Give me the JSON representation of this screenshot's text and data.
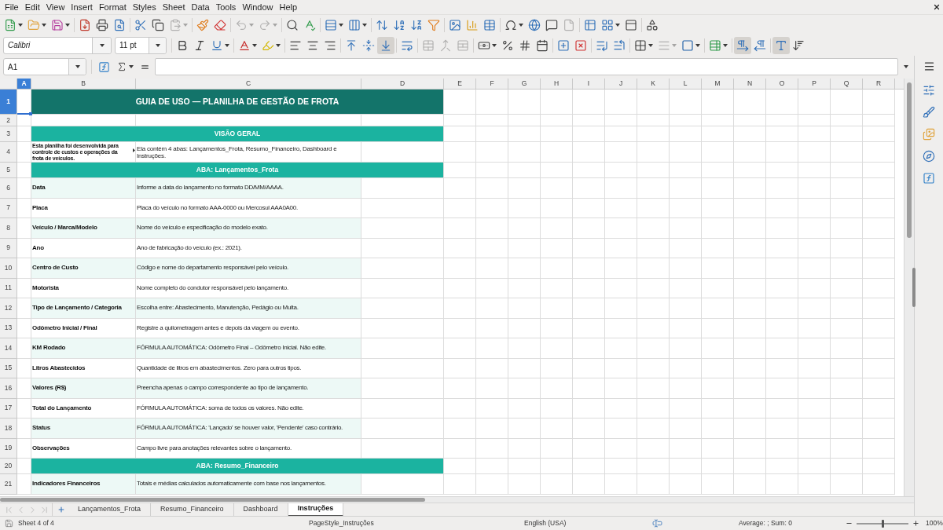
{
  "menu_bar": [
    "File",
    "Edit",
    "View",
    "Insert",
    "Format",
    "Styles",
    "Sheet",
    "Data",
    "Tools",
    "Window",
    "Help"
  ],
  "standard_toolbar": [
    {
      "kind": "new",
      "disabled": false
    },
    {
      "kind": "open",
      "disabled": false
    },
    {
      "kind": "save",
      "disabled": false
    },
    {
      "kind": "export_pdf",
      "disabled": false
    },
    {
      "kind": "print",
      "disabled": false
    },
    {
      "kind": "print_preview",
      "disabled": false
    },
    {
      "kind": "cut",
      "disabled": false
    },
    {
      "kind": "copy",
      "disabled": false
    },
    {
      "kind": "paste",
      "disabled": true
    },
    {
      "kind": "clone_formatting",
      "disabled": false
    },
    {
      "kind": "clear_formatting",
      "disabled": false
    },
    {
      "kind": "undo",
      "disabled": true
    },
    {
      "kind": "redo",
      "disabled": true
    },
    {
      "kind": "find_replace",
      "disabled": false
    },
    {
      "kind": "spelling",
      "disabled": false
    },
    {
      "kind": "row",
      "disabled": false
    },
    {
      "kind": "column",
      "disabled": false
    },
    {
      "kind": "sort",
      "disabled": false
    },
    {
      "kind": "sort_ascending",
      "disabled": false
    },
    {
      "kind": "sort_descending",
      "disabled": false
    },
    {
      "kind": "autofilter",
      "disabled": false
    },
    {
      "kind": "image",
      "disabled": false
    },
    {
      "kind": "chart",
      "disabled": false
    },
    {
      "kind": "pivot_table",
      "disabled": false
    },
    {
      "kind": "special_character",
      "disabled": false
    },
    {
      "kind": "hyperlink",
      "disabled": false
    },
    {
      "kind": "comment",
      "disabled": false
    },
    {
      "kind": "header_footer",
      "disabled": true
    },
    {
      "kind": "print_area",
      "disabled": false
    },
    {
      "kind": "freeze",
      "disabled": false
    },
    {
      "kind": "split_window",
      "disabled": false
    },
    {
      "kind": "draw_functions",
      "disabled": false
    }
  ],
  "formatting_toolbar": {
    "font_name": "Calibri",
    "font_size": "11 pt",
    "buttons": [
      {
        "kind": "bold",
        "disabled": false,
        "pressed": false
      },
      {
        "kind": "italic",
        "disabled": false,
        "pressed": false
      },
      {
        "kind": "underline",
        "disabled": false,
        "pressed": false
      },
      {
        "kind": "font_color",
        "disabled": false,
        "pressed": false
      },
      {
        "kind": "highlight",
        "disabled": false,
        "pressed": false
      },
      {
        "kind": "align_left",
        "disabled": false,
        "pressed": false
      },
      {
        "kind": "align_center",
        "disabled": false,
        "pressed": false
      },
      {
        "kind": "align_right",
        "disabled": false,
        "pressed": false
      },
      {
        "kind": "align_top",
        "disabled": false,
        "pressed": false
      },
      {
        "kind": "align_middle",
        "disabled": false,
        "pressed": false
      },
      {
        "kind": "align_bottom",
        "disabled": false,
        "pressed": true
      },
      {
        "kind": "wrap_text",
        "disabled": false,
        "pressed": false
      },
      {
        "kind": "merge_center",
        "disabled": true,
        "pressed": false
      },
      {
        "kind": "merge",
        "disabled": true,
        "pressed": false
      },
      {
        "kind": "unmerge",
        "disabled": true,
        "pressed": false
      },
      {
        "kind": "currency",
        "disabled": false,
        "pressed": false
      },
      {
        "kind": "percent",
        "disabled": false,
        "pressed": false
      },
      {
        "kind": "number",
        "disabled": false,
        "pressed": false
      },
      {
        "kind": "date",
        "disabled": false,
        "pressed": false
      },
      {
        "kind": "add_decimal",
        "disabled": false,
        "pressed": false
      },
      {
        "kind": "delete_decimal",
        "disabled": false,
        "pressed": false
      },
      {
        "kind": "increase_indent",
        "disabled": false,
        "pressed": false
      },
      {
        "kind": "decrease_indent",
        "disabled": false,
        "pressed": false
      },
      {
        "kind": "borders",
        "disabled": false,
        "pressed": false
      },
      {
        "kind": "border_style",
        "disabled": true,
        "pressed": false
      },
      {
        "kind": "border_color",
        "disabled": false,
        "pressed": false
      },
      {
        "kind": "conditional",
        "disabled": false,
        "pressed": false
      },
      {
        "kind": "left_to_right",
        "disabled": false,
        "pressed": true
      },
      {
        "kind": "right_to_left",
        "disabled": false,
        "pressed": false
      },
      {
        "kind": "text_horizontal",
        "disabled": false,
        "pressed": true
      },
      {
        "kind": "text_vertical",
        "disabled": false,
        "pressed": false
      }
    ]
  },
  "formula_bar": {
    "name_box": "A1"
  },
  "sheet": {
    "columns": [
      {
        "label": "A",
        "selected": true
      },
      {
        "label": "B",
        "selected": false
      },
      {
        "label": "C",
        "selected": false
      },
      {
        "label": "D",
        "selected": false
      },
      {
        "label": "E",
        "selected": false
      },
      {
        "label": "F",
        "selected": false
      },
      {
        "label": "G",
        "selected": false
      },
      {
        "label": "H",
        "selected": false
      },
      {
        "label": "I",
        "selected": false
      },
      {
        "label": "J",
        "selected": false
      },
      {
        "label": "K",
        "selected": false
      },
      {
        "label": "L",
        "selected": false
      },
      {
        "label": "M",
        "selected": false
      },
      {
        "label": "N",
        "selected": false
      },
      {
        "label": "O",
        "selected": false
      },
      {
        "label": "P",
        "selected": false
      },
      {
        "label": "Q",
        "selected": false
      },
      {
        "label": "R",
        "selected": false
      }
    ],
    "rows": [
      {
        "number": "1",
        "selected": true,
        "kind": "title",
        "text": "GUIA DE USO — PLANILHA DE GESTÃO DE FROTA"
      },
      {
        "number": "2",
        "selected": false,
        "kind": "blank"
      },
      {
        "number": "3",
        "selected": false,
        "kind": "section",
        "text": "VISÃO GERAL"
      },
      {
        "number": "4",
        "selected": false,
        "kind": "overview",
        "label": "Esta planilha foi desenvolvida para\ncontrole de custos e operações da\nfrota de veículos.",
        "label_clipped": true,
        "description": "Ela contém 4 abas: Lançamentos_Frota, Resumo_Financeiro, Dashboard e Instruções."
      },
      {
        "number": "5",
        "selected": false,
        "kind": "section",
        "text": "ABA: Lançamentos_Frota"
      },
      {
        "number": "6",
        "selected": false,
        "kind": "entry",
        "label": "Data",
        "description": "Informe a data do lançamento no formato DD/MM/AAAA."
      },
      {
        "number": "7",
        "selected": false,
        "kind": "entry",
        "label": "Placa",
        "description": "Placa do veículo no formato AAA-0000 ou Mercosul AAA0A00."
      },
      {
        "number": "8",
        "selected": false,
        "kind": "entry",
        "label": "Veículo / Marca/Modelo",
        "description": "Nome do veículo e especificação do modelo exato."
      },
      {
        "number": "9",
        "selected": false,
        "kind": "entry",
        "label": "Ano",
        "description": "Ano de fabricação do veículo (ex.: 2021)."
      },
      {
        "number": "10",
        "selected": false,
        "kind": "entry",
        "label": "Centro de Custo",
        "description": "Código e nome do departamento responsável pelo veículo."
      },
      {
        "number": "11",
        "selected": false,
        "kind": "entry",
        "label": "Motorista",
        "description": "Nome completo do condutor responsável pelo lançamento."
      },
      {
        "number": "12",
        "selected": false,
        "kind": "entry",
        "label": "Tipo de Lançamento / Categoria",
        "description": "Escolha entre: Abastecimento, Manutenção, Pedágio ou Multa."
      },
      {
        "number": "13",
        "selected": false,
        "kind": "entry",
        "label": "Odômetro Inicial / Final",
        "description": "Registre a quilometragem antes e depois da viagem ou evento."
      },
      {
        "number": "14",
        "selected": false,
        "kind": "entry",
        "label": "KM Rodado",
        "description": "FÓRMULA AUTOMÁTICA: Odômetro Final – Odômetro Inicial. Não edite."
      },
      {
        "number": "15",
        "selected": false,
        "kind": "entry",
        "label": "Litros Abastecidos",
        "description": "Quantidade de litros em abastecimentos. Zero para outros tipos."
      },
      {
        "number": "16",
        "selected": false,
        "kind": "entry",
        "label": "Valores (R$)",
        "description": "Preencha apenas o campo correspondente ao tipo de lançamento."
      },
      {
        "number": "17",
        "selected": false,
        "kind": "entry",
        "label": "Total do Lançamento",
        "description": "FÓRMULA AUTOMÁTICA: soma de todos os valores. Não edite."
      },
      {
        "number": "18",
        "selected": false,
        "kind": "entry",
        "label": "Status",
        "description": "FÓRMULA AUTOMÁTICA: 'Lançado' se houver valor, 'Pendente' caso contrário."
      },
      {
        "number": "19",
        "selected": false,
        "kind": "entry",
        "label": "Observações",
        "description": "Campo livre para anotações relevantes sobre o lançamento."
      },
      {
        "number": "20",
        "selected": false,
        "kind": "section",
        "text": "ABA: Resumo_Financeiro"
      },
      {
        "number": "21",
        "selected": false,
        "kind": "entry",
        "label": "Indicadores Financeiros",
        "description": "Totais e médias calculados automaticamente com base nos lançamentos."
      }
    ]
  },
  "sheet_navigation": [
    {
      "kind": "first",
      "disabled": true
    },
    {
      "kind": "previous",
      "disabled": true
    },
    {
      "kind": "next",
      "disabled": true
    },
    {
      "kind": "last",
      "disabled": true
    }
  ],
  "sheet_tabs": [
    {
      "label": "Lançamentos_Frota",
      "selected": false
    },
    {
      "label": "Resumo_Financeiro",
      "selected": false
    },
    {
      "label": "Dashboard",
      "selected": false
    },
    {
      "label": "Instruções",
      "selected": true
    }
  ],
  "status_bar": {
    "sheet_position": "Sheet 4 of 4",
    "page_style": "PageStyle_Instruções",
    "language": "English (USA)",
    "selection_summary": "Average: ; Sum: 0",
    "zoom_slider": {
      "level": 0.5
    },
    "zoom": "100%"
  }
}
